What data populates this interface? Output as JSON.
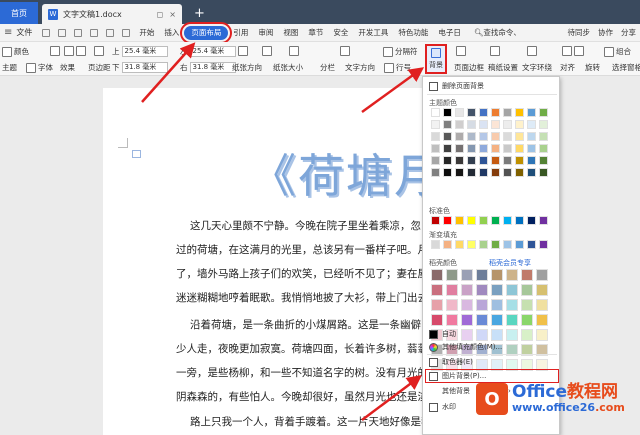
{
  "titlebar": {
    "home_tab": "首页",
    "doc_tab": "文字文稿1.docx",
    "doc_icon": "W",
    "close": "×",
    "add": "+"
  },
  "menubar": {
    "file": "文件",
    "items": [
      "开始",
      "插入",
      "页面布局",
      "引用",
      "审阅",
      "视图",
      "章节",
      "安全",
      "开发工具",
      "特色功能",
      "电子日"
    ],
    "search": "查找命令、",
    "right": [
      "待同步",
      "协作",
      "分享"
    ]
  },
  "ribbon": {
    "row1": {
      "color": "颜色",
      "effect": "效果",
      "margin_top_label": "上",
      "margin_top_value": "25.4 毫米",
      "margin_left_label": "左",
      "margin_left_value": "25.4 毫米",
      "separator": "分隔符",
      "page_border": "页面边框",
      "merge": "组合"
    },
    "row2": {
      "theme": "主题",
      "font": "字体",
      "effects": "效果",
      "margins": "页边距",
      "margin_bottom_label": "下",
      "margin_bottom_value": "31.8 毫米",
      "margin_right_label": "右",
      "margin_right_value": "31.8 毫米",
      "orientation": "纸张方向",
      "size": "纸张大小",
      "columns": "分栏",
      "text_direction": "文字方向",
      "line_no": "行号",
      "background": "背景",
      "page_border2": "页面边框",
      "paper_settings": "稿纸设置",
      "wrap": "文字环绕",
      "align": "对齐",
      "rotate": "旋转",
      "select_pane": "选择窗格"
    }
  },
  "document": {
    "title": "《荷塘月色》",
    "paragraphs": [
      "这几天心里颇不宁静。今晚在院子里坐着乘凉，忽",
      "过的荷塘，在这满月的光里，总该另有一番样子吧。月",
      "了，墙外马路上孩子们的欢笑，已经听不见了；妻在屋里",
      "迷迷糊糊地哼着眠歌。我悄悄地披了大衫，带上门出去",
      "沿着荷塘，是一条曲折的小煤屑路。这是一条幽僻",
      "少人走，夜晚更加寂寞。荷塘四面，长着许多树，蓊蓊",
      "一旁，是些杨柳，和一些不知道名字的树。没有月光的",
      "阴森森的，有些怕人。今晚却很好，虽然月光也还是淡",
      "路上只我一个人，背着手踱着。这一片天地好像是我"
    ]
  },
  "dropdown": {
    "remove": "删除页面背景",
    "theme_colors": "主题颜色",
    "standard_colors": "标准色",
    "gradient_fill": "渐变填充",
    "texture_colors": "稻壳颜色",
    "member": "稻壳会员专享",
    "auto": "自动",
    "other_fill": "其他填充颜色(M)...",
    "eyedropper": "取色器(E)",
    "picture_bg": "图片背景(P)...",
    "other_bg": "其他背景",
    "watermark": "水印"
  },
  "palette": {
    "theme": [
      [
        "#ffffff",
        "#000000",
        "#e7e6e6",
        "#44546a",
        "#4472c4",
        "#ed7d31",
        "#a5a5a5",
        "#ffc000",
        "#5b9bd5",
        "#70ad47"
      ],
      [
        "#f2f2f2",
        "#7f7f7f",
        "#d0cece",
        "#d6dce4",
        "#dae3f3",
        "#fbe5d6",
        "#ededed",
        "#fff2cc",
        "#deebf7",
        "#e2f0d9"
      ],
      [
        "#d9d9d9",
        "#595959",
        "#aeabab",
        "#adb9ca",
        "#b4c7e7",
        "#f8cbad",
        "#dbdbdb",
        "#ffe699",
        "#bdd7ee",
        "#c5e0b4"
      ],
      [
        "#bfbfbf",
        "#404040",
        "#757171",
        "#8497b0",
        "#8faadc",
        "#f4b183",
        "#c9c9c9",
        "#ffd966",
        "#9dc3e6",
        "#a9d18e"
      ],
      [
        "#a6a6a6",
        "#262626",
        "#3a3838",
        "#333f50",
        "#2f5597",
        "#c55a11",
        "#7b7b7b",
        "#bf9000",
        "#2e75b6",
        "#548235"
      ],
      [
        "#808080",
        "#0d0d0d",
        "#171616",
        "#222a35",
        "#203864",
        "#843c0c",
        "#525252",
        "#7f6000",
        "#1f4e79",
        "#385723"
      ]
    ],
    "standard": [
      "#c00000",
      "#ff0000",
      "#ffc000",
      "#ffff00",
      "#92d050",
      "#00b050",
      "#00b0f0",
      "#0070c0",
      "#002060",
      "#7030a0"
    ],
    "gradient": [
      "#d9d9d9",
      "#f4b183",
      "#ffd966",
      "#ffff66",
      "#a9d18e",
      "#70ad47",
      "#9dc3e6",
      "#5b9bd5",
      "#2f5597",
      "#7030a0"
    ],
    "texture": [
      [
        "#8a6a6a",
        "#8f9a8a",
        "#9aa0b5",
        "#6e7e9a",
        "#b6946a",
        "#cdb38a",
        "#c07a6a",
        "#a0a0a0"
      ],
      [
        "#c96f7e",
        "#e07ea0",
        "#c9a2c6",
        "#a08abf",
        "#7aa0c0",
        "#8ec6d6",
        "#a6c79a",
        "#d6c070"
      ],
      [
        "#e6a1a9",
        "#f0b8c8",
        "#d9b8e0",
        "#b9a6d8",
        "#9fbfe0",
        "#a6dfe6",
        "#c6e0b0",
        "#f0e0a0"
      ],
      [
        "#d64a6a",
        "#f07aa0",
        "#a06ad6",
        "#6a8ad6",
        "#4aa6e0",
        "#5ad6c0",
        "#8ad66a",
        "#f0c04a"
      ],
      [
        "#f0c8d0",
        "#f8d8e0",
        "#e8d0f0",
        "#d0d8f8",
        "#c8e0f8",
        "#c8f0f0",
        "#d8f0c8",
        "#f8f0c8"
      ],
      [
        "#b0b0b0",
        "#d0a0b0",
        "#c0b0d0",
        "#a0b0d0",
        "#a0c0d0",
        "#b0d0c0",
        "#c0d0a0",
        "#d0c0a0"
      ],
      [
        "#e0e0e0",
        "#f8e0e8",
        "#f0e8f8",
        "#e0e8f8",
        "#e0f0f8",
        "#e0f8f0",
        "#ecf8e0",
        "#f8f4e0"
      ]
    ]
  },
  "watermark": {
    "logo": "O",
    "brand_en": "Office",
    "brand_cn": "教程网",
    "url_en": "www.office26",
    "url_cn": ".com"
  }
}
